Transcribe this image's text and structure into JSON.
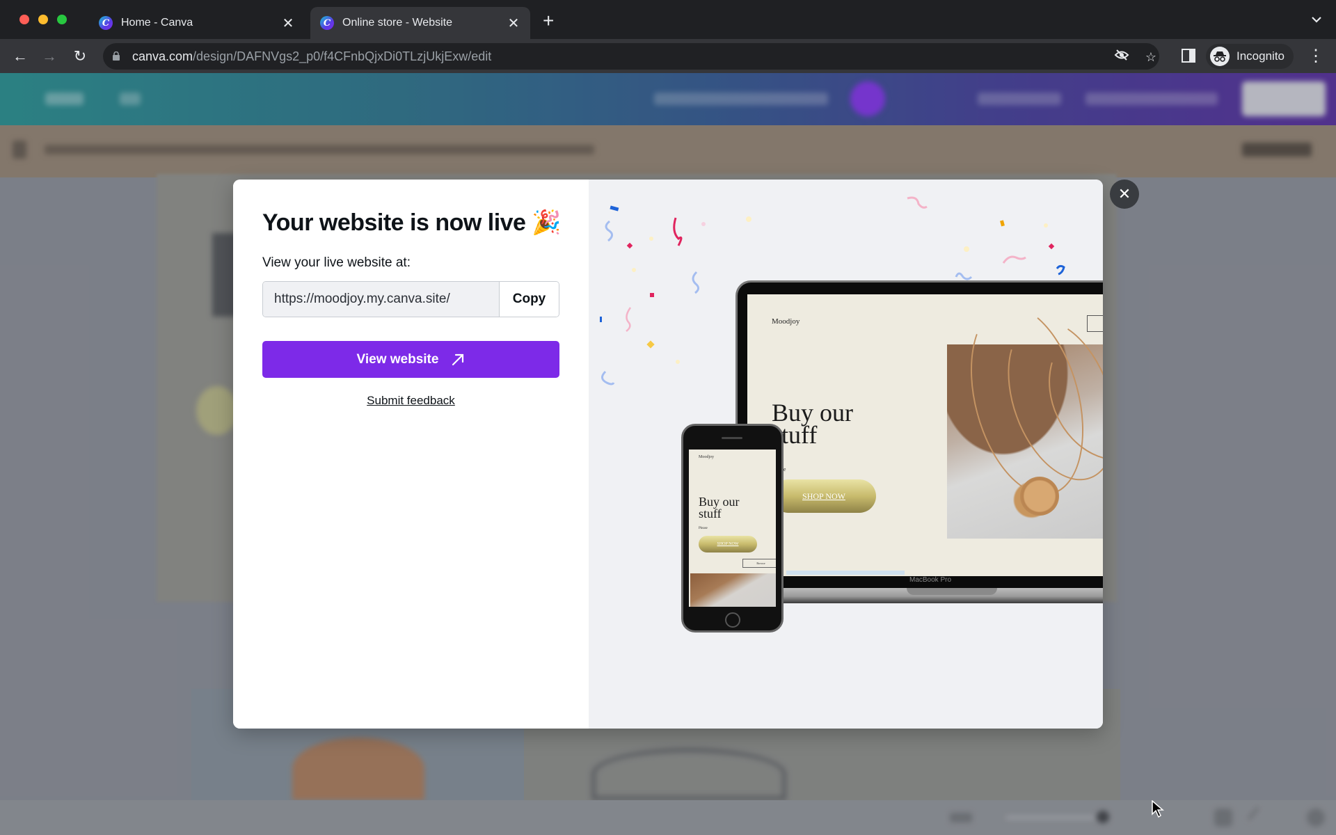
{
  "browser": {
    "tabs": [
      {
        "title": "Home - Canva",
        "favicon": "canva-logo-icon",
        "active": false
      },
      {
        "title": "Online store - Website",
        "favicon": "canva-logo-icon",
        "active": true
      }
    ],
    "new_tab_label": "+",
    "address": {
      "host": "canva.com",
      "path": "/design/DAFNVgs2_p0/f4CFnbQjxDi0TLzjUkjExw/edit"
    },
    "profile_label": "Incognito",
    "icons": {
      "back": "←",
      "forward": "→",
      "reload": "↻",
      "close_tab": "✕",
      "menu": "⋮",
      "tab_search": "⌄",
      "star": "☆"
    }
  },
  "modal": {
    "title": "Your website is now live",
    "title_emoji": "🎉",
    "label": "View your live website at:",
    "url_value": "https://moodjoy.my.canva.site/",
    "copy_label": "Copy",
    "view_label": "View website",
    "feedback_label": "Submit feedback",
    "close_icon": "✕",
    "accent_color": "#7d2ae8"
  },
  "preview": {
    "laptop": {
      "brand": "Moodjoy",
      "headline_line1": "Buy our",
      "headline_line2": "stuff",
      "subtext": "Please",
      "button_label": "SHOP NOW",
      "device_label": "MacBook Pro"
    },
    "phone": {
      "brand": "Moodjoy",
      "headline_line1": "Buy our",
      "headline_line2": "stuff",
      "subtext": "Please",
      "button_label": "SHOP NOW",
      "box_label": "Browse"
    }
  }
}
